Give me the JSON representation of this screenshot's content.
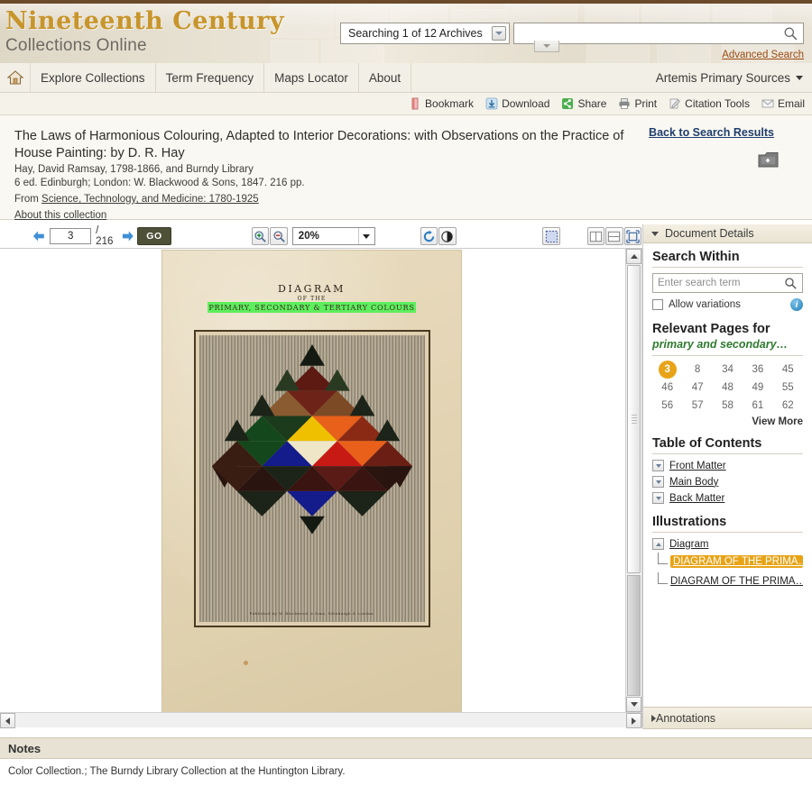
{
  "banner": {
    "logo_line1": "Nineteenth Century",
    "logo_line2": "Collections Online",
    "archive_selector": "Searching 1 of 12 Archives",
    "search_placeholder": "",
    "search_value": "",
    "advanced_search": "Advanced Search",
    "search_icon": "search-icon",
    "accent_gold": "#c8952b"
  },
  "nav": {
    "home_icon": "home-icon",
    "items": [
      {
        "label": "Explore Collections"
      },
      {
        "label": "Term Frequency"
      },
      {
        "label": "Maps Locator"
      },
      {
        "label": "About"
      }
    ],
    "account": "Artemis Primary Sources"
  },
  "actions": [
    {
      "label": "Bookmark",
      "icon": "bookmark-icon"
    },
    {
      "label": "Download",
      "icon": "download-icon"
    },
    {
      "label": "Share",
      "icon": "share-icon"
    },
    {
      "label": "Print",
      "icon": "print-icon"
    },
    {
      "label": "Citation Tools",
      "icon": "citation-tools-icon"
    },
    {
      "label": "Email",
      "icon": "email-icon"
    }
  ],
  "citation": {
    "title": "The Laws of Harmonious Colouring, Adapted to Interior Decorations: with Observations on the Practice of House Painting: by D. R. Hay",
    "author": "Hay, David Ramsay, 1798-1866, and Burndy Library",
    "imprint": "6 ed. Edinburgh; London: W. Blackwood & Sons, 1847. 216 pp.",
    "from_prefix": "From ",
    "from_link": "Science, Technology, and Medicine: 1780-1925",
    "about_link": "About this collection",
    "back_to_results": "Back to Search Results",
    "save_icon": "save-to-folder-icon"
  },
  "viewer_toolbar": {
    "prev_icon": "arrow-left-icon",
    "next_icon": "arrow-right-icon",
    "page_value": "3",
    "page_total": "/ 216",
    "go_label": "GO",
    "zoom_in_icon": "zoom-in-icon",
    "zoom_out_icon": "zoom-out-icon",
    "zoom_value": "20%",
    "rotate_icon": "rotate-icon",
    "contrast_icon": "contrast-icon",
    "select_region_icon": "select-region-icon",
    "two_page_icon": "two-page-view-icon",
    "one_page_icon": "one-page-view-icon",
    "fit_page_icon": "fit-page-icon"
  },
  "document_page": {
    "title": "DIAGRAM",
    "of_the": "OF THE",
    "subtitle": "PRIMARY, SECONDARY & TERTIARY COLOURS",
    "highlight_color": "#5dee5d",
    "caption": "Published by W. Blackwood & Sons, Edinburgh & London."
  },
  "chart_data": {
    "type": "diagram",
    "title": "DIAGRAM OF THE PRIMARY, SECONDARY & TERTIARY COLOURS",
    "note": "Triangular colour chart: rows of upward/downward triangles forming a large triangle with clipped corners.",
    "rows": [
      {
        "row": 1,
        "colors": [
          "#1c2318",
          "#5c1a12",
          "#23301c"
        ]
      },
      {
        "row": 2,
        "colors": [
          "#8a5a30",
          "#6d2318",
          "#7d4a26",
          "#8a5a30"
        ]
      },
      {
        "row": 3,
        "colors": [
          "#1c3a1c",
          "#14481c",
          "#efc000",
          "#e8601a",
          "#8b2a14"
        ]
      },
      {
        "row": 4,
        "colors": [
          "#3a1d12",
          "#14481c",
          "#141b8a",
          "#efe6c8",
          "#c81a14",
          "#e8601a",
          "#6b1f14"
        ]
      },
      {
        "row": 5,
        "colors": [
          "#3a1d12",
          "#2a1410",
          "#5c2a16",
          "#1c2318",
          "#5a1a16",
          "#3a1410"
        ]
      },
      {
        "row": 6,
        "colors": [
          "#1c2318",
          "#141b8a",
          "#1c2318"
        ]
      }
    ]
  },
  "panel": {
    "header": "Document Details",
    "header_caret": "chevron-down-icon",
    "search_within": {
      "heading": "Search Within",
      "placeholder": "Enter search term",
      "value": "",
      "search_icon": "search-icon",
      "checkbox_label": "Allow variations",
      "checked": false,
      "info_icon": "info-icon"
    },
    "relevant_pages": {
      "heading": "Relevant Pages for",
      "query": "primary and secondary…",
      "current": "3",
      "pages": [
        "3",
        "8",
        "34",
        "36",
        "45",
        "46",
        "47",
        "48",
        "49",
        "55",
        "56",
        "57",
        "58",
        "61",
        "62"
      ],
      "view_more": "View More",
      "highlight_color": "#e8a317",
      "query_color": "#2f7a2f"
    },
    "table_of_contents": {
      "heading": "Table of Contents",
      "items": [
        {
          "label": "Front Matter",
          "expanded": false
        },
        {
          "label": "Main Body",
          "expanded": false
        },
        {
          "label": "Back Matter",
          "expanded": false
        }
      ]
    },
    "illustrations": {
      "heading": "Illustrations",
      "group": "Diagram",
      "group_expanded": true,
      "items": [
        {
          "label": "DIAGRAM OF THE PRIMA…",
          "selected": true
        },
        {
          "label": "DIAGRAM OF THE PRIMA…",
          "selected": false
        }
      ]
    },
    "annotations": {
      "label": "Annotations",
      "caret": "chevron-right-icon"
    }
  },
  "notes": {
    "heading": "Notes",
    "body": "Color Collection.; The Burndy Library Collection at the Huntington Library."
  }
}
